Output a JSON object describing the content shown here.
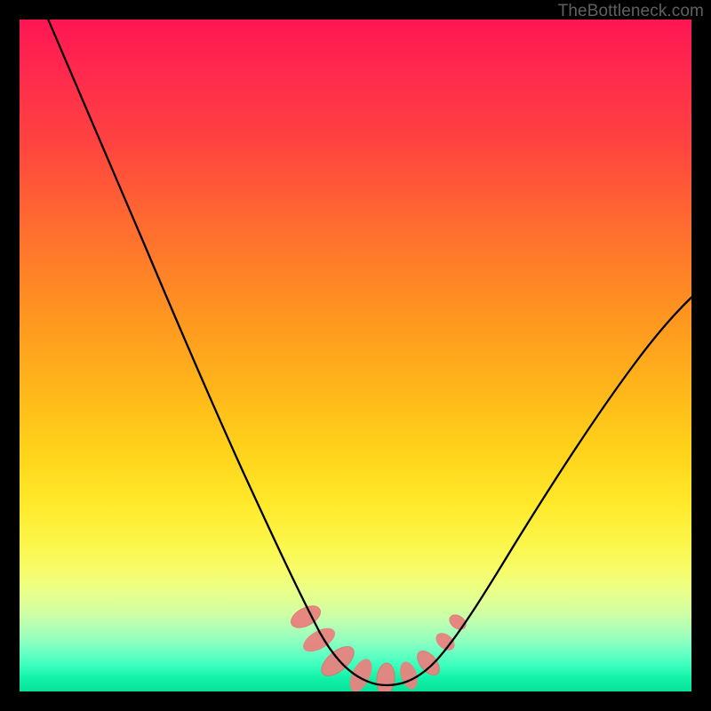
{
  "watermark": "TheBottleneck.com",
  "colors": {
    "background": "#000000",
    "curve": "#000000",
    "band_fill": "#e8827e",
    "band_stroke": "#de6a65",
    "gradient_top": "#ff1653",
    "gradient_bottom": "#06e29a",
    "watermark": "#606060"
  },
  "chart_data": {
    "type": "line",
    "title": "",
    "xlabel": "",
    "ylabel": "",
    "ylim": [
      0,
      100
    ],
    "xlim": [
      0,
      100
    ],
    "curve_points": [
      {
        "x": 4,
        "y": 100
      },
      {
        "x": 6,
        "y": 96
      },
      {
        "x": 10,
        "y": 88
      },
      {
        "x": 16,
        "y": 74
      },
      {
        "x": 22,
        "y": 60
      },
      {
        "x": 28,
        "y": 46
      },
      {
        "x": 32,
        "y": 36
      },
      {
        "x": 36,
        "y": 26
      },
      {
        "x": 40,
        "y": 16
      },
      {
        "x": 42.5,
        "y": 10
      },
      {
        "x": 45,
        "y": 5
      },
      {
        "x": 48,
        "y": 2
      },
      {
        "x": 51,
        "y": 1
      },
      {
        "x": 54,
        "y": 1
      },
      {
        "x": 57,
        "y": 2
      },
      {
        "x": 60,
        "y": 4.5
      },
      {
        "x": 64,
        "y": 9
      },
      {
        "x": 70,
        "y": 18
      },
      {
        "x": 76,
        "y": 28
      },
      {
        "x": 82,
        "y": 38
      },
      {
        "x": 88,
        "y": 48
      },
      {
        "x": 94,
        "y": 56
      },
      {
        "x": 100,
        "y": 62
      }
    ],
    "confidence_band_upper": [
      {
        "x": 43,
        "y": 11
      },
      {
        "x": 45,
        "y": 7
      },
      {
        "x": 48,
        "y": 3.5
      },
      {
        "x": 51,
        "y": 2.2
      },
      {
        "x": 54,
        "y": 2.2
      },
      {
        "x": 57,
        "y": 3.5
      },
      {
        "x": 60,
        "y": 6
      },
      {
        "x": 62.5,
        "y": 9
      },
      {
        "x": 64.5,
        "y": 12
      }
    ],
    "confidence_band_lower": [
      {
        "x": 43,
        "y": 9
      },
      {
        "x": 45,
        "y": 4
      },
      {
        "x": 48,
        "y": 1
      },
      {
        "x": 51,
        "y": 0.2
      },
      {
        "x": 54,
        "y": 0.2
      },
      {
        "x": 57,
        "y": 0.8
      },
      {
        "x": 60,
        "y": 3
      },
      {
        "x": 62.5,
        "y": 6.5
      },
      {
        "x": 64.5,
        "y": 10
      }
    ],
    "annotations": []
  }
}
